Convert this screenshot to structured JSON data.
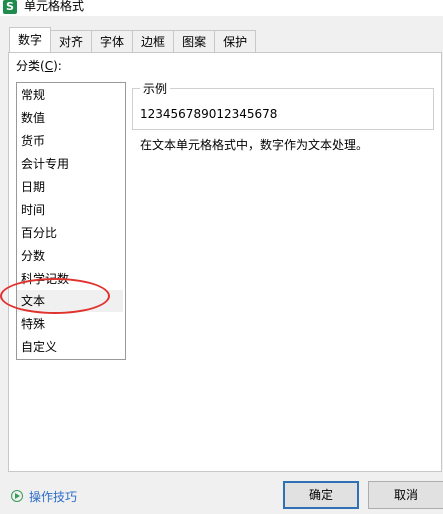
{
  "window": {
    "title": "单元格格式",
    "icon_letter": "S"
  },
  "tabs": [
    {
      "label": "数字",
      "active": true
    },
    {
      "label": "对齐",
      "active": false
    },
    {
      "label": "字体",
      "active": false
    },
    {
      "label": "边框",
      "active": false
    },
    {
      "label": "图案",
      "active": false
    },
    {
      "label": "保护",
      "active": false
    }
  ],
  "category": {
    "label_prefix": "分类(",
    "label_key": "C",
    "label_suffix": "):",
    "items": [
      "常规",
      "数值",
      "货币",
      "会计专用",
      "日期",
      "时间",
      "百分比",
      "分数",
      "科学记数",
      "文本",
      "特殊",
      "自定义"
    ],
    "selected": "文本"
  },
  "sample": {
    "legend": "示例",
    "value": "123456789012345678"
  },
  "description": "在文本单元格格式中，数字作为文本处理。",
  "footer": {
    "tips_label": "操作技巧",
    "ok_label": "确定",
    "cancel_label": "取消"
  },
  "colors": {
    "annotation": "#e0332e",
    "link": "#2d6cc8",
    "brand": "#1f8b4c",
    "primary_border": "#2f6fb3"
  }
}
